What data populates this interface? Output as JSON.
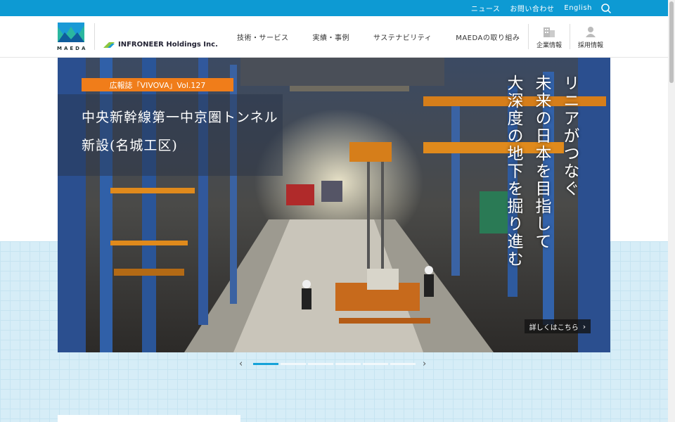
{
  "topbar": {
    "links": [
      "ニュース",
      "お問い合わせ",
      "English"
    ],
    "search_icon": "search-icon"
  },
  "header": {
    "logo_text": "MAEDA",
    "group_name": "INFRONEER Holdings Inc.",
    "nav": [
      "技術・サービス",
      "実績・事例",
      "サステナビリティ",
      "MAEDAの取り組み"
    ],
    "util": [
      {
        "label": "企業情報",
        "icon": "building-icon"
      },
      {
        "label": "採用情報",
        "icon": "person-icon"
      }
    ]
  },
  "hero": {
    "badge": "広報誌「VIVOVA」Vol.127",
    "title_line1": "中央新幹線第一中京圏トンネル",
    "title_line2": "新設(名城工区)",
    "vertical_lines": [
      "リニアがつなぐ",
      "未来の日本を目指して",
      "大深度の地下を掘り進む"
    ],
    "more_label": "詳しくはこちら"
  },
  "pager": {
    "prev": "‹",
    "next": "›",
    "count": 6,
    "active": 0
  },
  "colors": {
    "brand_blue": "#0d9ad3",
    "accent_orange": "#f07d1a",
    "grid_bg": "#d6edf7"
  }
}
